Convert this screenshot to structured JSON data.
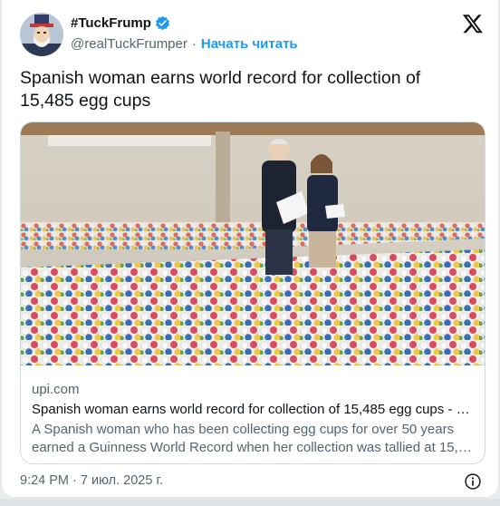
{
  "author": {
    "display_name": "#TuckFrump",
    "handle": "@realTuckFrumper",
    "separator": "·",
    "follow_label": "Начать читать"
  },
  "tweet": {
    "text": "Spanish woman earns world record for collection of 15,485 egg cups"
  },
  "link_card": {
    "domain": "upi.com",
    "title": "Spanish woman earns world record for collection of 15,485 egg cups - U…",
    "description_line1": "A Spanish woman who has been collecting egg cups for over 50 years",
    "description_line2": "earned a Guinness World Record when her collection was tallied at 15,4…"
  },
  "footer": {
    "timestamp": "9:24 PM · 7 июл. 2025 г."
  },
  "icons": {
    "verified": "verified-badge-icon",
    "brand": "x-logo-icon",
    "info": "info-icon"
  },
  "colors": {
    "accent": "#1d9bf0",
    "text": "#0f1419",
    "muted": "#536471",
    "border": "#cfd9de"
  }
}
